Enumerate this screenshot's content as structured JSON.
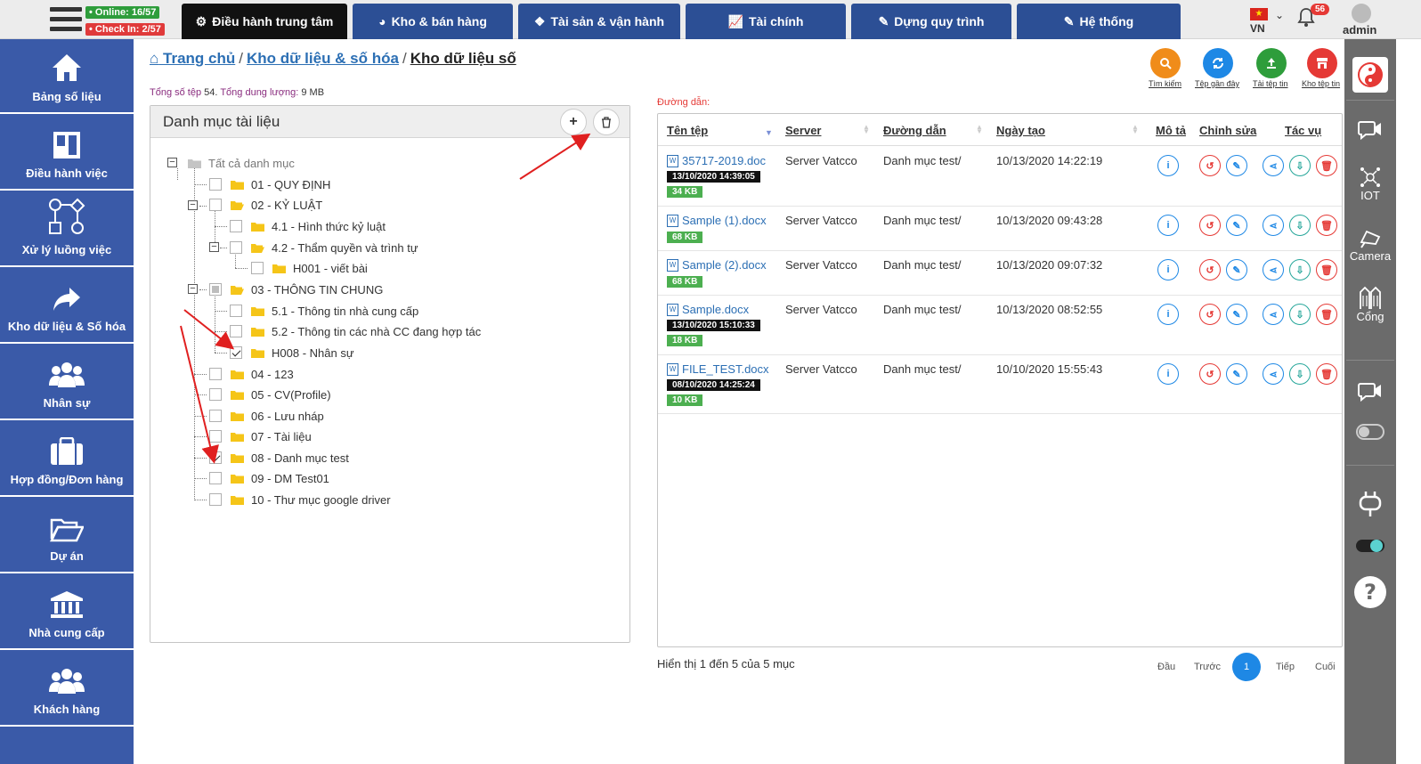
{
  "topbar": {
    "online": "• Online: 16/57",
    "checkin": "• Check In: 2/57",
    "tabs": [
      {
        "label": "Điều hành trung tâm",
        "icon": "gear-icon"
      },
      {
        "label": "Kho & bán hàng",
        "icon": "pie-icon"
      },
      {
        "label": "Tài sản & vận hành",
        "icon": "cubes-icon"
      },
      {
        "label": "Tài chính",
        "icon": "chart-icon"
      },
      {
        "label": "Dựng quy trình",
        "icon": "edit-icon"
      },
      {
        "label": "Hệ thống",
        "icon": "edit-icon"
      }
    ],
    "lang": "VN",
    "notif_count": "56",
    "user": "admin"
  },
  "sidebar": {
    "items": [
      {
        "label": "Bảng số liệu",
        "icon": "home-icon"
      },
      {
        "label": "Điều hành việc",
        "icon": "board-icon"
      },
      {
        "label": "Xử lý luồng việc",
        "icon": "flow-icon"
      },
      {
        "label": "Kho dữ liệu & Số hóa",
        "icon": "share-arrow-icon"
      },
      {
        "label": "Nhân sự",
        "icon": "users-icon"
      },
      {
        "label": "Hợp đồng/Đơn hàng",
        "icon": "briefcase-icon"
      },
      {
        "label": "Dự án",
        "icon": "folder-open-icon"
      },
      {
        "label": "Nhà cung cấp",
        "icon": "bank-icon"
      },
      {
        "label": "Khách hàng",
        "icon": "users-icon"
      }
    ]
  },
  "rightbar": {
    "iot": "IOT",
    "camera": "Camera",
    "cong": "Cổng"
  },
  "breadcrumb": {
    "home": "Trang chủ",
    "level1": "Kho dữ liệu & số hóa",
    "current": "Kho dữ liệu số"
  },
  "summary": {
    "files_label": "Tổng số tệp",
    "files_value": "54",
    "size_label": "Tổng dung lượng:",
    "size_value": "9 MB"
  },
  "tree": {
    "title": "Danh mục tài liệu",
    "root": "Tất cả danh mục",
    "nodes": [
      {
        "label": "01 - QUY ĐỊNH",
        "state": "none"
      },
      {
        "label": "02 - KỶ LUẬT",
        "state": "none"
      },
      {
        "label": "4.1 - Hình thức kỷ luật",
        "state": "none"
      },
      {
        "label": "4.2 - Thẩm quyền và trình tự",
        "state": "none"
      },
      {
        "label": "H001 - viết bài",
        "state": "none"
      },
      {
        "label": "03 - THÔNG TIN CHUNG",
        "state": "indeterminate"
      },
      {
        "label": "5.1 - Thông tin nhà cung cấp",
        "state": "none"
      },
      {
        "label": "5.2 - Thông tin các nhà CC đang hợp tác",
        "state": "none"
      },
      {
        "label": "H008 - Nhân sự",
        "state": "checked"
      },
      {
        "label": "04 - 123",
        "state": "none"
      },
      {
        "label": "05 - CV(Profile)",
        "state": "none"
      },
      {
        "label": "06 - Lưu nháp",
        "state": "none"
      },
      {
        "label": "07 - Tài liệu",
        "state": "none"
      },
      {
        "label": "08 - Danh mục test",
        "state": "checked"
      },
      {
        "label": "09 - DM Test01",
        "state": "none"
      },
      {
        "label": "10 - Thư mục google driver",
        "state": "none"
      }
    ]
  },
  "actions": {
    "search": "Tìm kiếm",
    "recent": "Tệp gần đây",
    "upload": "Tải tệp tin",
    "store": "Kho tệp tin"
  },
  "path_label": "Đường dẫn:",
  "table": {
    "headers": {
      "name": "Tên tệp",
      "server": "Server",
      "path": "Đường dẫn",
      "date": "Ngày tạo",
      "desc": "Mô tả",
      "edit": "Chỉnh sửa",
      "action": "Tác vụ"
    },
    "rows": [
      {
        "name": "35717-2019.doc",
        "time": "13/10/2020 14:39:05",
        "size": "34 KB",
        "server": "Server Vatcco",
        "path": "Danh mục test/",
        "date": "10/13/2020 14:22:19"
      },
      {
        "name": "Sample (1).docx",
        "time": "",
        "size": "68 KB",
        "server": "Server Vatcco",
        "path": "Danh mục test/",
        "date": "10/13/2020 09:43:28"
      },
      {
        "name": "Sample (2).docx",
        "time": "",
        "size": "68 KB",
        "server": "Server Vatcco",
        "path": "Danh mục test/",
        "date": "10/13/2020 09:07:32"
      },
      {
        "name": "Sample.docx",
        "time": "13/10/2020 15:10:33",
        "size": "18 KB",
        "server": "Server Vatcco",
        "path": "Danh mục test/",
        "date": "10/13/2020 08:52:55"
      },
      {
        "name": "FILE_TEST.docx",
        "time": "08/10/2020 14:25:24",
        "size": "10 KB",
        "server": "Server Vatcco",
        "path": "Danh mục test/",
        "date": "10/10/2020 15:55:43"
      }
    ]
  },
  "footer": {
    "info": "Hiển thị 1 đến 5 của 5 mục",
    "first": "Đầu",
    "prev": "Trước",
    "page": "1",
    "next": "Tiếp",
    "last": "Cuối"
  },
  "colors": {
    "nav": "#2c4f95",
    "sidebar": "#3a5aa8",
    "link": "#2c6fb4",
    "annotation": "#e02020"
  }
}
